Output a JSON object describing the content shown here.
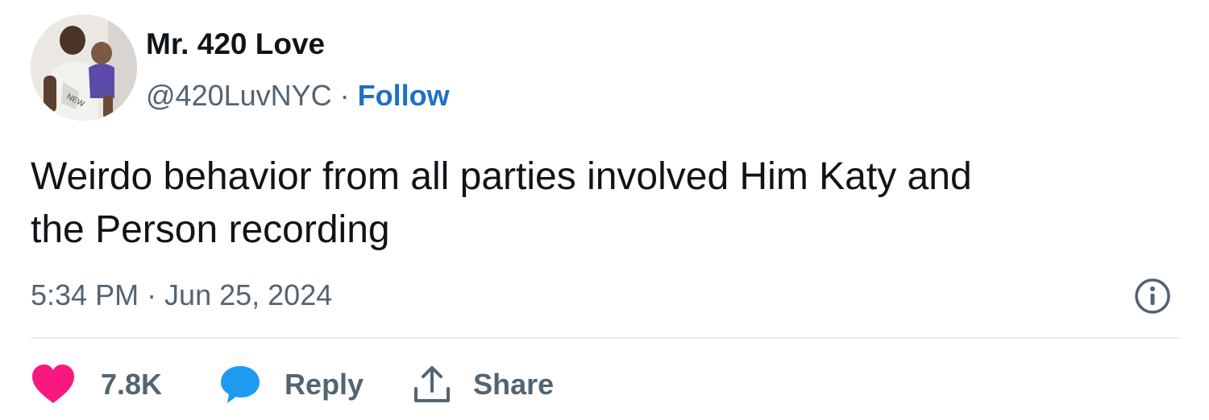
{
  "author": {
    "display_name": "Mr. 420 Love",
    "handle": "@420LuvNYC",
    "separator": "·",
    "follow_label": "Follow"
  },
  "tweet": {
    "text_lines": [
      "Weirdo behavior from all parties involved Him Katy and",
      "the Person recording"
    ],
    "timestamp": "5:34 PM · Jun 25, 2024"
  },
  "actions": {
    "like_count": "7.8K",
    "reply_label": "Reply",
    "share_label": "Share"
  },
  "icons": {
    "avatar": "profile-photo",
    "info": "info-icon",
    "like": "heart-icon",
    "reply": "speech-bubble-icon",
    "share": "share-upload-icon"
  },
  "colors": {
    "follow": "#1d70c8",
    "heart": "#f91880",
    "reply_bubble": "#1d9bf0",
    "muted_text": "#536471",
    "primary_text": "#0f1419"
  }
}
